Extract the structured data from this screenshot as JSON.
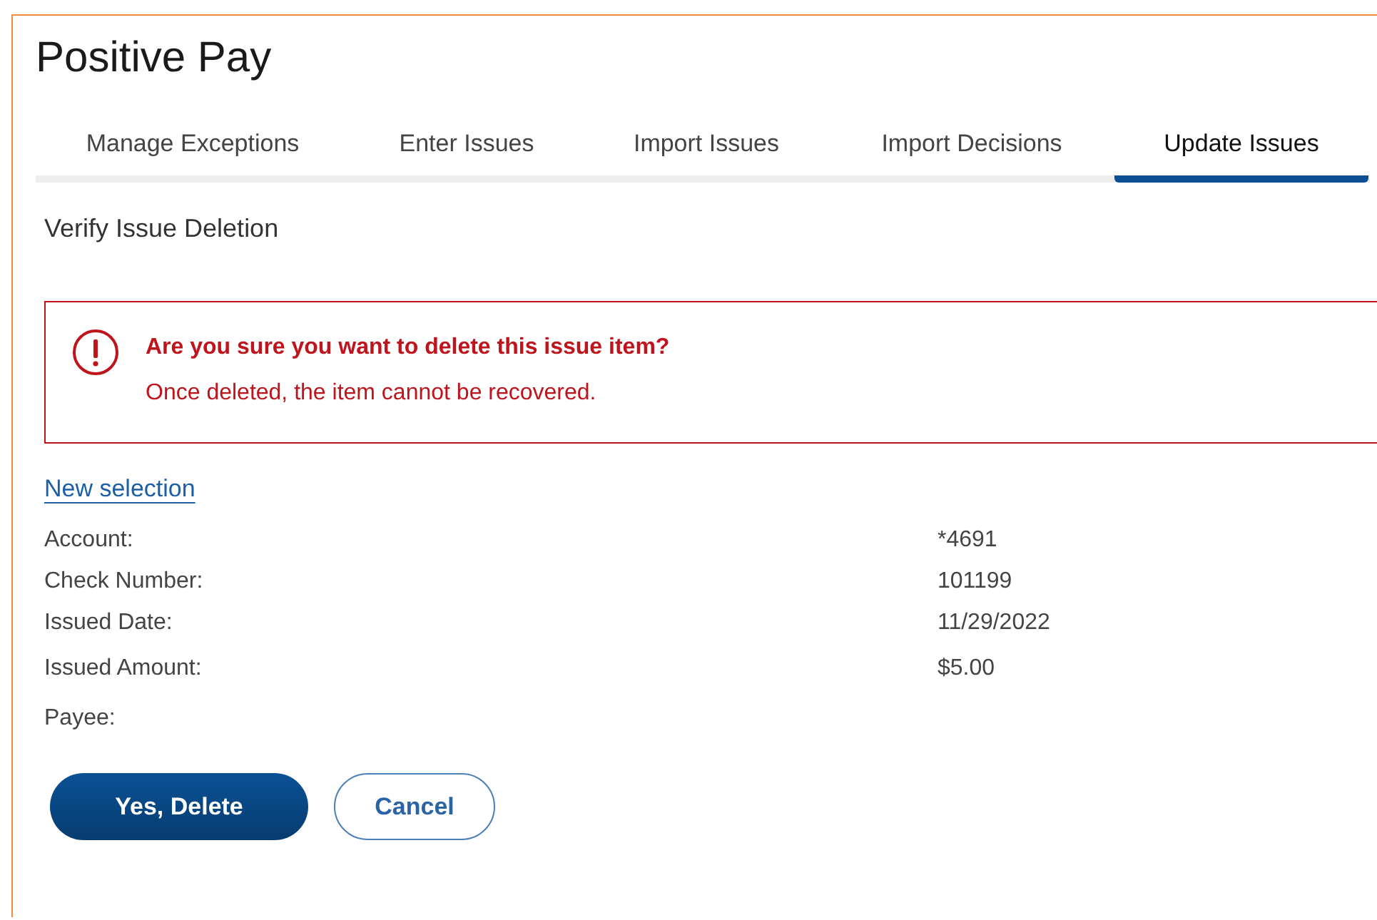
{
  "page": {
    "title": "Positive Pay"
  },
  "tabs": [
    {
      "label": "Manage Exceptions",
      "selected": false
    },
    {
      "label": "Enter Issues",
      "selected": false
    },
    {
      "label": "Import Issues",
      "selected": false
    },
    {
      "label": "Import Decisions",
      "selected": false
    },
    {
      "label": "Update Issues",
      "selected": true
    }
  ],
  "section_title": "Verify Issue Deletion",
  "alert": {
    "kind": "error",
    "heading": "Are you sure you want to delete this issue item?",
    "message": "Once deleted, the item cannot be recovered."
  },
  "link": "New selection",
  "details": [
    {
      "label": "Account:",
      "value": "*4691"
    },
    {
      "label": "Check Number:",
      "value": "101199"
    },
    {
      "label": "Issued Date:",
      "value": "11/29/2022"
    },
    {
      "label": "Issued Amount:",
      "value": "$5.00"
    },
    {
      "label": "Payee:"
    }
  ],
  "buttons": [
    {
      "label": "Yes, Delete",
      "kind": "primary"
    },
    {
      "label": "Cancel",
      "kind": "secondary"
    }
  ]
}
